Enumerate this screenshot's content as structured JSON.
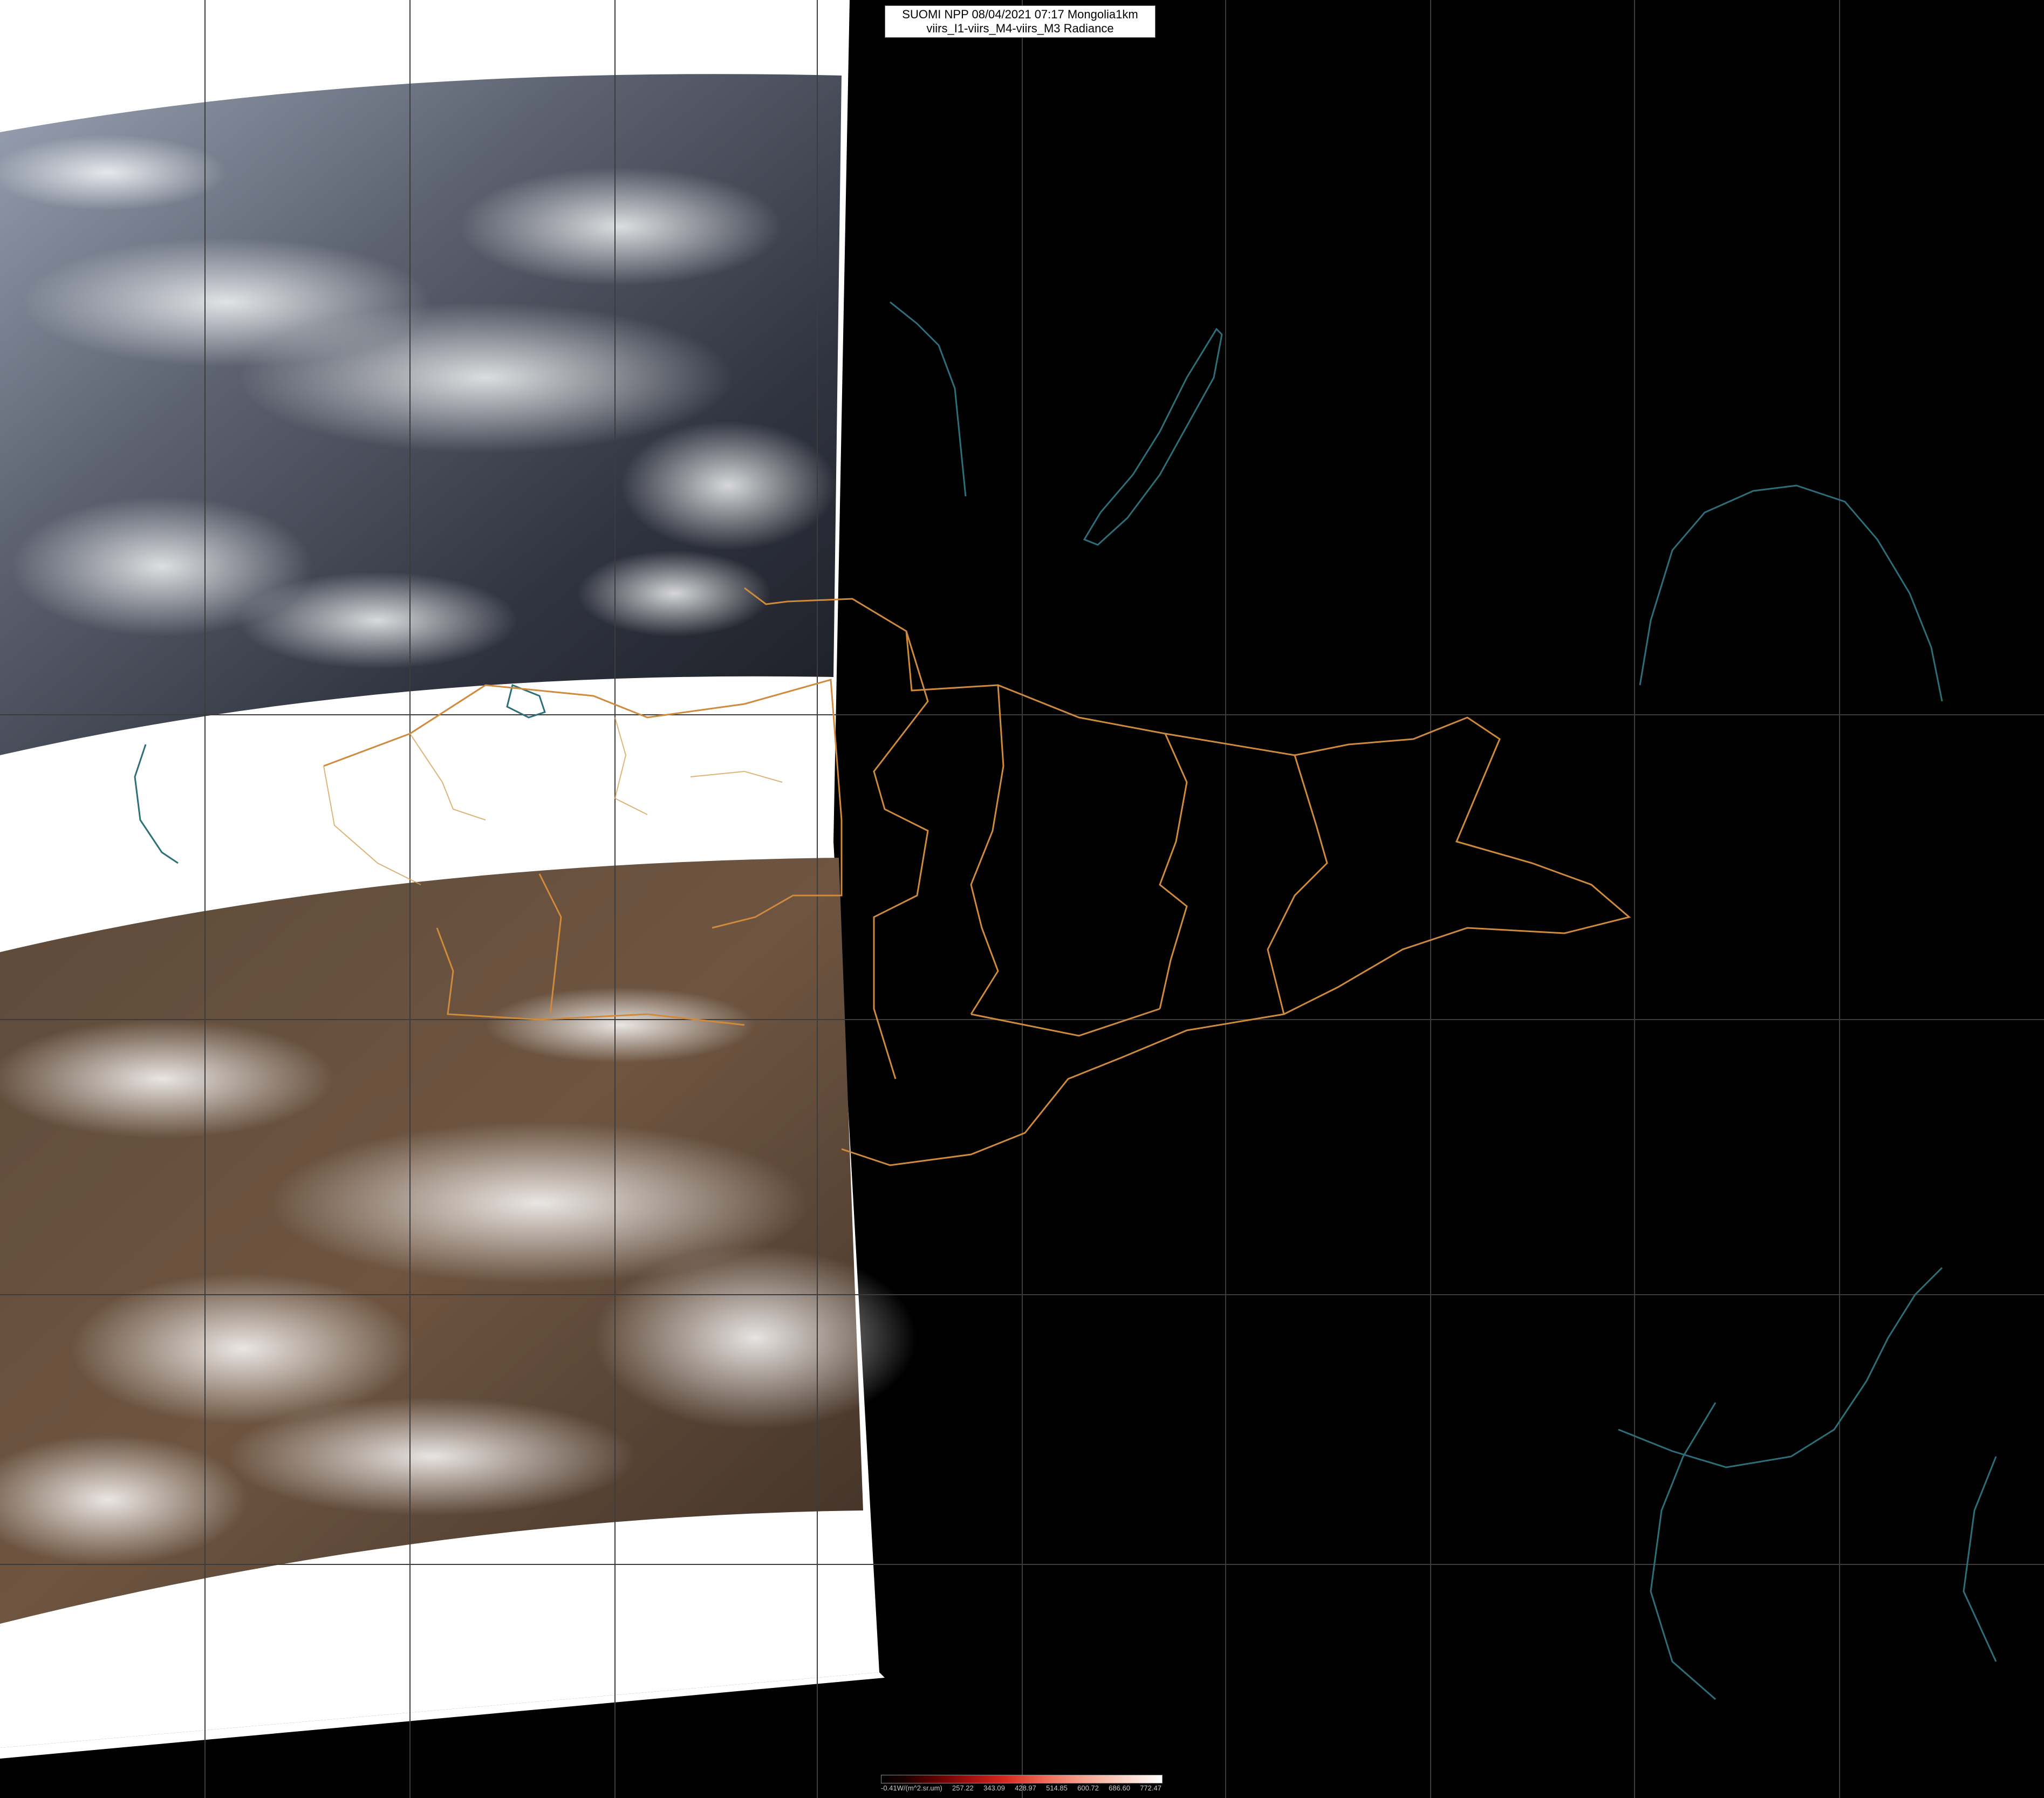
{
  "title": {
    "line1": "SUOMI NPP 08/04/2021 07:17 Mongolia1km",
    "line2": "viirs_I1-viirs_M4-viirs_M3 Radiance"
  },
  "colorbar": {
    "labels": [
      "-0.41W/(m^2.sr.um)",
      "257.22",
      "343.09",
      "428.97",
      "514.85",
      "600.72",
      "686.60",
      "772.47"
    ]
  },
  "colors": {
    "background": "#000000",
    "no_data": "#ffffff",
    "border_lines": "#d08a3c",
    "coast_lines": "#2c6f7a",
    "grid_lines": "#3a3a3a"
  }
}
